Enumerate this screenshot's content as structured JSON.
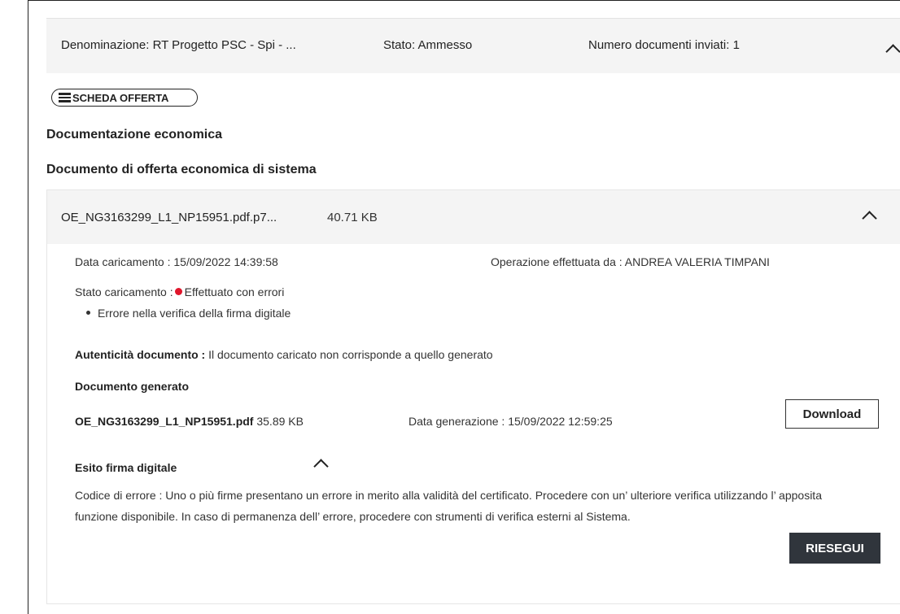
{
  "header": {
    "denominazione": "Denominazione: RT Progetto PSC - Spi - ...",
    "stato": "Stato: Ammesso",
    "numero_documenti": "Numero documenti inviati: 1",
    "chevron_icon": "chevron-up-icon"
  },
  "scheda_button": {
    "label": "SCHEDA OFFERTA",
    "icon": "list-icon"
  },
  "sections": {
    "documentazione": "Documentazione economica",
    "documento_offerta": "Documento di offerta economica di sistema"
  },
  "file": {
    "name": "OE_NG3163299_L1_NP15951.pdf.p7...",
    "size": "40.71 KB",
    "data_caricamento": "Data caricamento : 15/09/2022 14:39:58",
    "operazione": "Operazione effettuata da : ANDREA VALERIA TIMPANI",
    "stato_caricamento_label": "Stato caricamento :",
    "stato_caricamento_value": "Effettuato con errori",
    "status_color": "#e0162b",
    "errors": [
      "Errore nella verifica della firma digitale"
    ],
    "autenticita_label": "Autenticità documento :",
    "autenticita_value": "Il documento caricato non corrisponde a quello generato",
    "documento_generato_title": "Documento generato",
    "generated_name": "OE_NG3163299_L1_NP15951.pdf",
    "generated_size": "35.89 KB",
    "data_generazione": "Data generazione : 15/09/2022 12:59:25",
    "download_label": "Download",
    "esito_title": "Esito firma digitale",
    "esito_text": "Codice di errore : Uno o più firme presentano un errore in merito alla validità del certificato. Procedere con un’ ulteriore verifica utilizzando l’ apposita funzione disponibile. In caso di permanenza dell’ errore, procedere con strumenti di verifica esterni al Sistema.",
    "riesegui_label": "RIESEGUI"
  }
}
